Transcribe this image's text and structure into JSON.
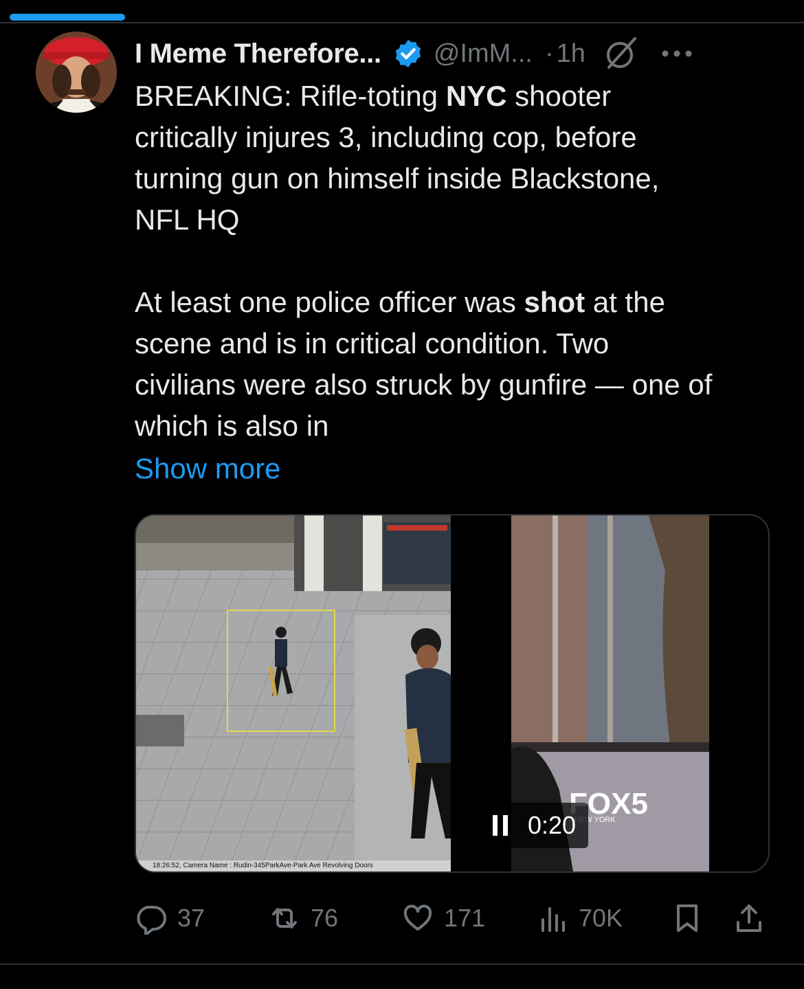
{
  "tweet": {
    "display_name": "I Meme Therefore...",
    "handle": "@ImM...",
    "separator": "·",
    "time": "1h",
    "body_line1_a": "BREAKING: Rifle-toting ",
    "body_line1_bold": "NYC",
    "body_line1_b": " shooter\ncritically injures 3, including cop, before\nturning gun on himself inside Blackstone,\nNFL HQ\n\nAt least one police officer was ",
    "body_bold2": "shot",
    "body_rest": " at the\nscene and is in critical condition. Two\ncivilians were also struck by gunfire — one of\nwhich is also in",
    "show_more": "Show more",
    "media": {
      "video_time": "0:20",
      "camera_caption": "18:26:52, Camera Name : Rudin-345ParkAve-Park Ave Revolving Doors",
      "watermark": "FOX5",
      "watermark_sub": "NEW YORK"
    },
    "actions": {
      "replies": "37",
      "reposts": "76",
      "likes": "171",
      "views": "70K"
    }
  },
  "colors": {
    "background": "#000000",
    "text": "#e7e9ea",
    "secondary": "#71767b",
    "accent": "#1d9bf0",
    "divider": "#2f3336"
  },
  "icons": [
    "verified-badge-icon",
    "grok-icon",
    "more-icon",
    "reply-icon",
    "repost-icon",
    "like-icon",
    "views-icon",
    "bookmark-icon",
    "share-icon",
    "pause-icon"
  ]
}
